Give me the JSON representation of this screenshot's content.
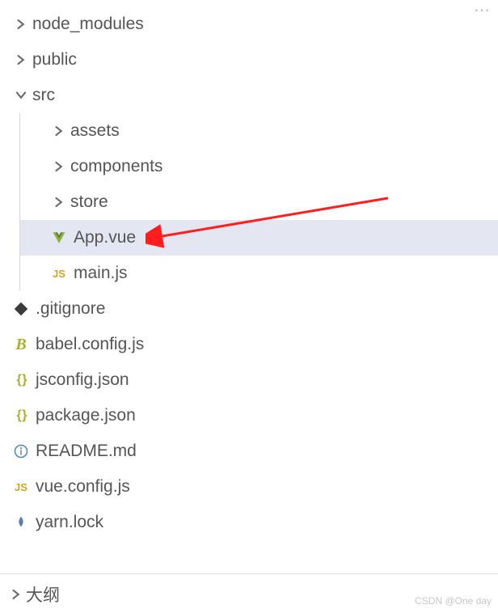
{
  "tree": {
    "items": [
      {
        "label": "node_modules",
        "type": "folder",
        "expanded": false,
        "indent": 0,
        "icon": "chevron"
      },
      {
        "label": "public",
        "type": "folder",
        "expanded": false,
        "indent": 0,
        "icon": "chevron"
      },
      {
        "label": "src",
        "type": "folder",
        "expanded": true,
        "indent": 0,
        "icon": "chevron-down"
      },
      {
        "label": "assets",
        "type": "folder",
        "expanded": false,
        "indent": 1,
        "icon": "chevron"
      },
      {
        "label": "components",
        "type": "folder",
        "expanded": false,
        "indent": 1,
        "icon": "chevron"
      },
      {
        "label": "store",
        "type": "folder",
        "expanded": false,
        "indent": 1,
        "icon": "chevron"
      },
      {
        "label": "App.vue",
        "type": "file",
        "indent": 1,
        "icon": "vue",
        "selected": true
      },
      {
        "label": "main.js",
        "type": "file",
        "indent": 1,
        "icon": "js"
      },
      {
        "label": ".gitignore",
        "type": "file",
        "indent": 0,
        "icon": "git"
      },
      {
        "label": "babel.config.js",
        "type": "file",
        "indent": 0,
        "icon": "babel"
      },
      {
        "label": "jsconfig.json",
        "type": "file",
        "indent": 0,
        "icon": "json"
      },
      {
        "label": "package.json",
        "type": "file",
        "indent": 0,
        "icon": "json"
      },
      {
        "label": "README.md",
        "type": "file",
        "indent": 0,
        "icon": "info"
      },
      {
        "label": "vue.config.js",
        "type": "file",
        "indent": 0,
        "icon": "js"
      },
      {
        "label": "yarn.lock",
        "type": "file",
        "indent": 0,
        "icon": "lock"
      }
    ]
  },
  "outline": {
    "label": "大纲"
  },
  "watermark": "CSDN @One day"
}
